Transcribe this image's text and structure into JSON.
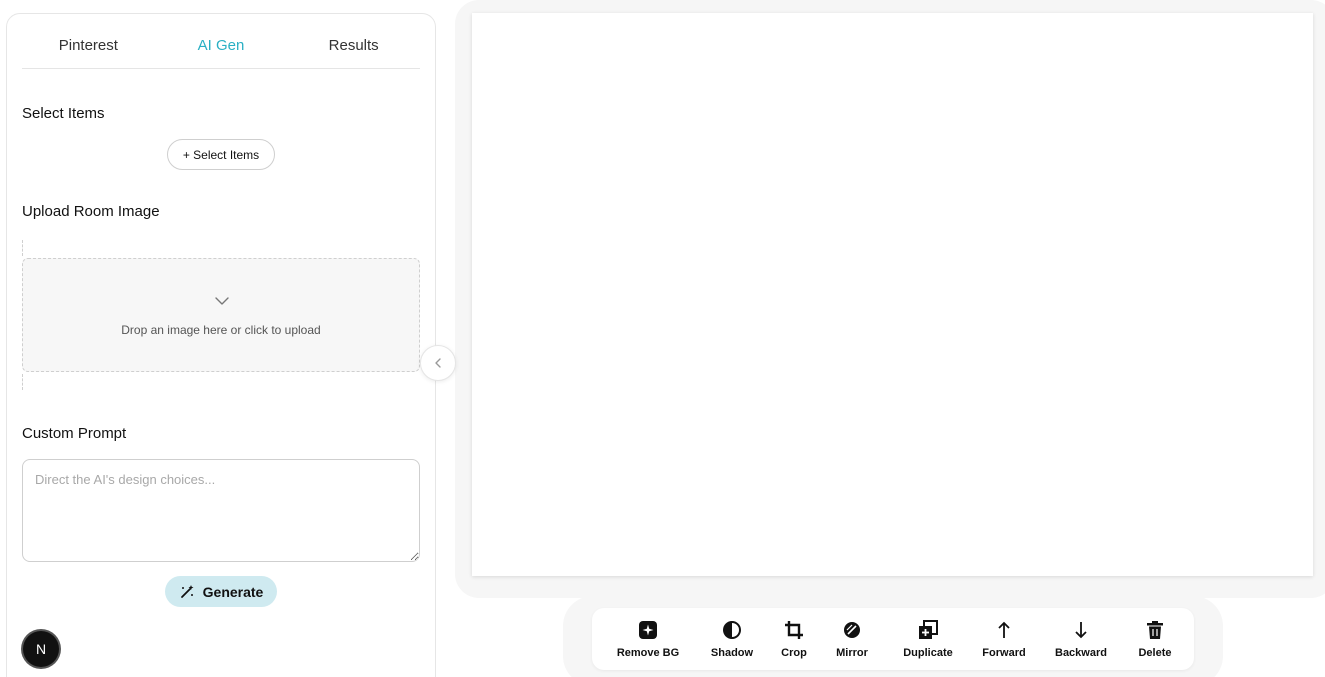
{
  "tabs": [
    {
      "label": "Pinterest",
      "active": false
    },
    {
      "label": "AI Gen",
      "active": true
    },
    {
      "label": "Results",
      "active": false
    }
  ],
  "select_items": {
    "title": "Select Items",
    "button_label": "+ Select Items"
  },
  "upload": {
    "title": "Upload Room Image",
    "drop_text": "Drop an image here or click to upload",
    "icon": "chevron-down-icon"
  },
  "prompt": {
    "title": "Custom Prompt",
    "placeholder": "Direct the AI's design choices...",
    "value": ""
  },
  "generate": {
    "label": "Generate",
    "icon": "magic-wand-icon"
  },
  "avatar": {
    "letter": "N"
  },
  "toolbar": {
    "items": [
      {
        "label": "Remove BG",
        "icon": "remove-bg-icon"
      },
      {
        "label": "Shadow",
        "icon": "shadow-icon"
      },
      {
        "label": "Crop",
        "icon": "crop-icon"
      },
      {
        "label": "Mirror",
        "icon": "mirror-icon"
      },
      {
        "label": "Duplicate",
        "icon": "duplicate-icon"
      },
      {
        "label": "Forward",
        "icon": "arrow-up-icon"
      },
      {
        "label": "Backward",
        "icon": "arrow-down-icon"
      },
      {
        "label": "Delete",
        "icon": "trash-icon"
      }
    ]
  },
  "colors": {
    "accent": "#2ab0c4",
    "generate_bg": "#cfeaf0",
    "canvas_bg": "#f6f6f6"
  }
}
